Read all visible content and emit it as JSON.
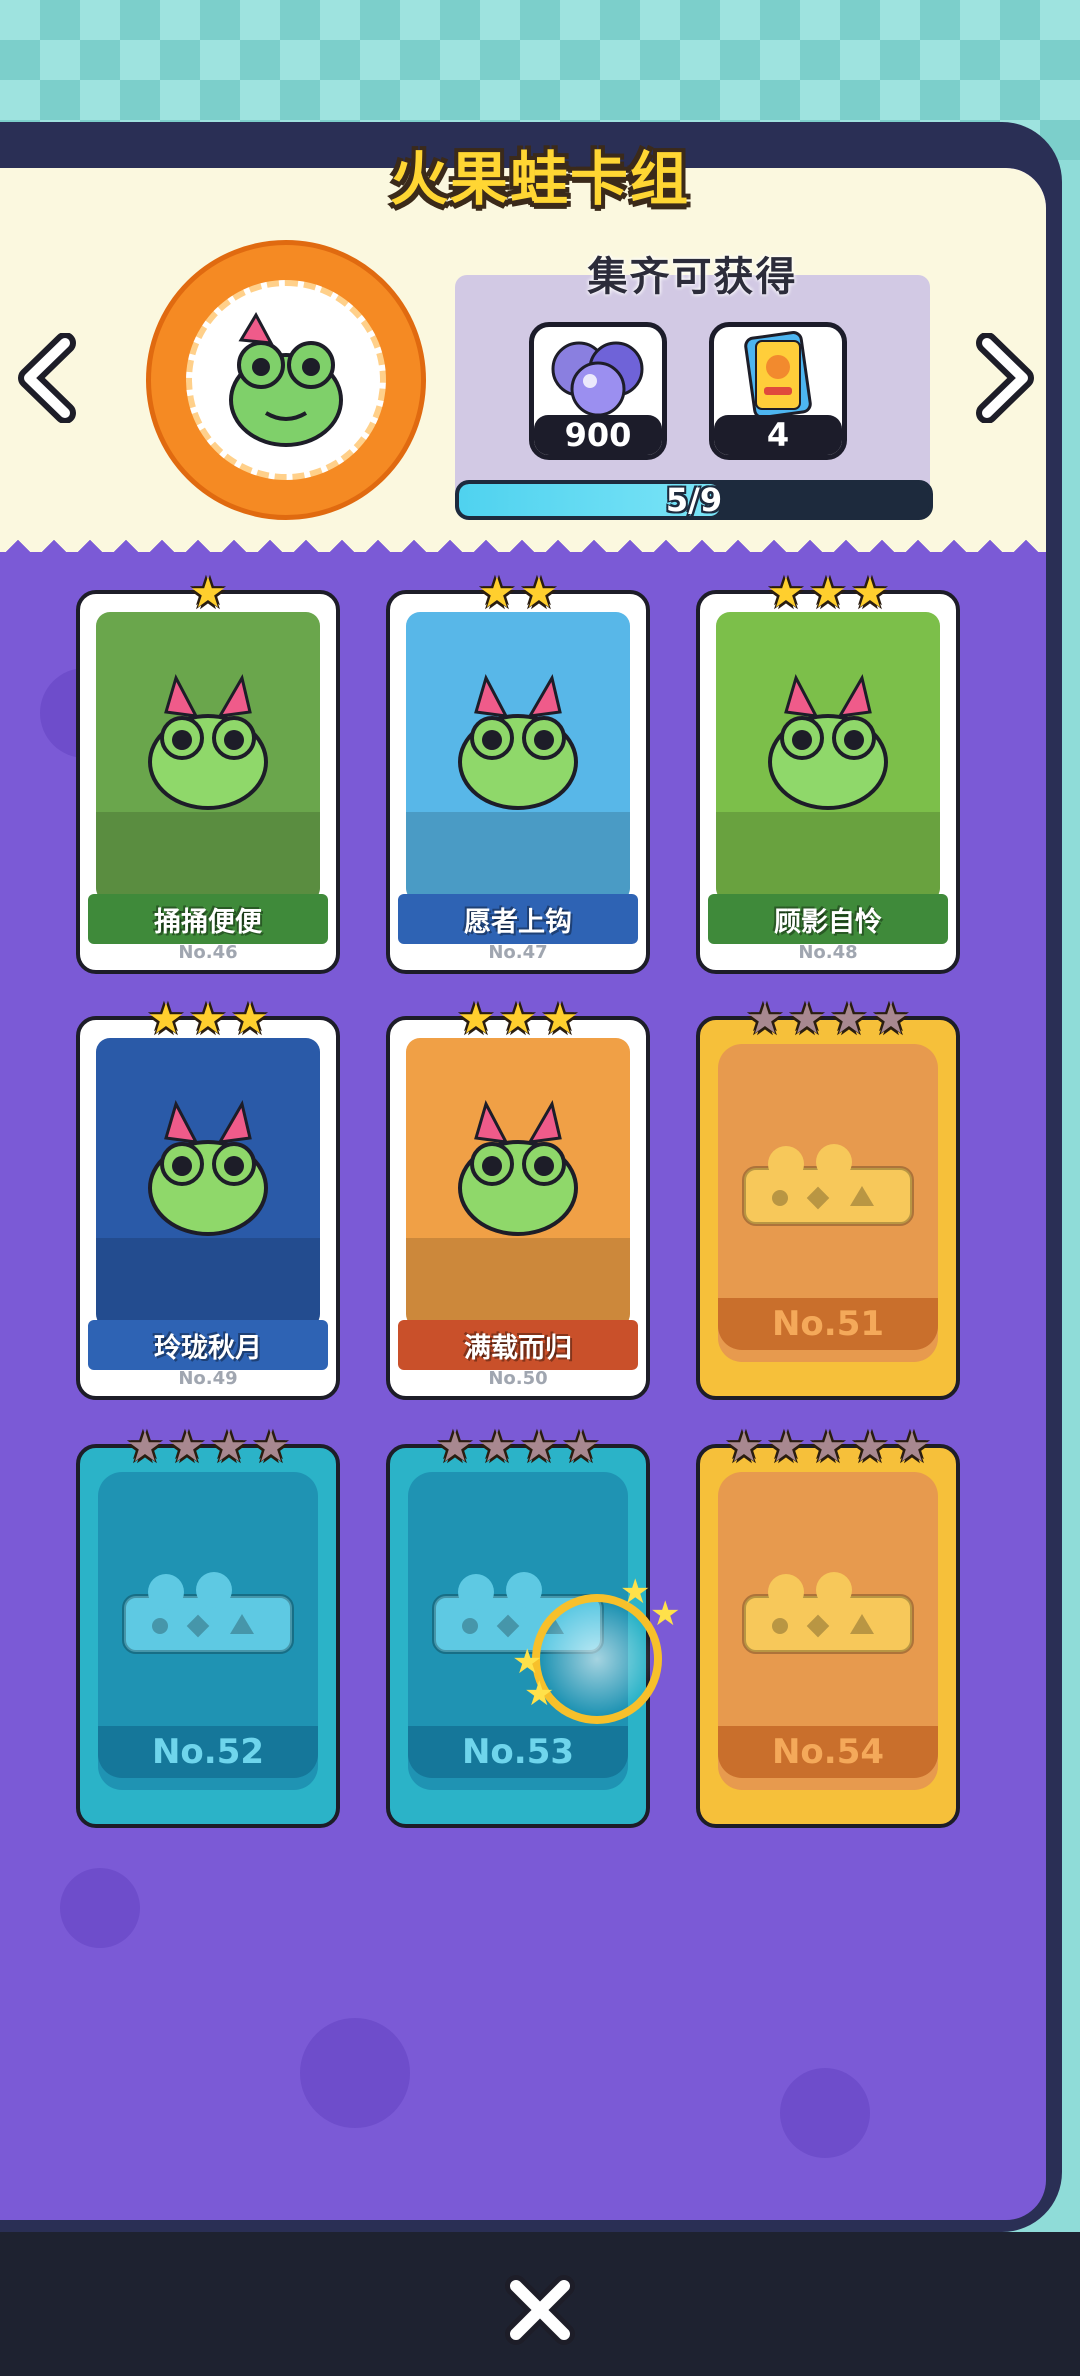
{
  "title": "火果蛙卡组",
  "reward": {
    "label": "集齐可获得",
    "items": [
      {
        "icon": "gem-orbs-icon",
        "count": "900"
      },
      {
        "icon": "card-pack-icon",
        "count": "4"
      }
    ],
    "progress_text": "5/9",
    "progress_value": 0.5556
  },
  "cards": [
    {
      "name": "捅捅便便",
      "number": "No.46",
      "stars": 1,
      "unlocked": true,
      "ribbon_color": "#3f8a3a",
      "art_bg": "#6aa64c"
    },
    {
      "name": "愿者上钩",
      "number": "No.47",
      "stars": 2,
      "unlocked": true,
      "ribbon_color": "#2e63b4",
      "art_bg": "#58b7e8"
    },
    {
      "name": "顾影自怜",
      "number": "No.48",
      "stars": 3,
      "unlocked": true,
      "ribbon_color": "#3f8a3a",
      "art_bg": "#7cbf4a"
    },
    {
      "name": "玲珑秋月",
      "number": "No.49",
      "stars": 3,
      "unlocked": true,
      "ribbon_color": "#2e63b4",
      "art_bg": "#2a5aa8"
    },
    {
      "name": "满载而归",
      "number": "No.50",
      "stars": 3,
      "unlocked": true,
      "ribbon_color": "#c9502a",
      "art_bg": "#f0a046"
    },
    {
      "number": "No.51",
      "stars": 4,
      "unlocked": false,
      "style": "orange"
    },
    {
      "number": "No.52",
      "stars": 4,
      "unlocked": false,
      "style": "teal"
    },
    {
      "number": "No.53",
      "stars": 4,
      "unlocked": false,
      "style": "teal"
    },
    {
      "number": "No.54",
      "stars": 5,
      "unlocked": false,
      "style": "orange"
    }
  ],
  "icons": {
    "prev": "chevron-left-icon",
    "next": "chevron-right-icon",
    "close": "close-icon",
    "medallion": "frog-avatar-icon"
  }
}
